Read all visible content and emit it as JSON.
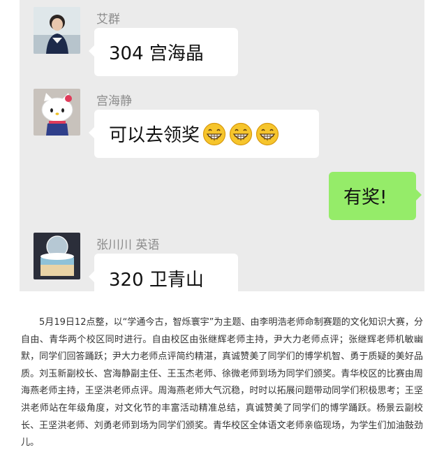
{
  "chat": {
    "messages": [
      {
        "sender": "艾群",
        "text": "304 宫海晶",
        "avatar": "avatar-woman-photo"
      },
      {
        "sender": "宫海静",
        "text": "可以去领奖",
        "emoji_count": 3,
        "emoji": "grinning-face-emoji",
        "avatar": "avatar-hello-kitty"
      },
      {
        "sender": "",
        "text": "有奖!",
        "self": true
      },
      {
        "sender": "张川川 英语",
        "text": "320 卫青山",
        "avatar": "avatar-cake-photo"
      }
    ],
    "colors": {
      "background": "#ebebeb",
      "self_bubble": "#95ec69",
      "other_bubble": "#ffffff"
    }
  },
  "article": {
    "paragraph": "5月19日12点整，以“学通今古，智烁寰宇”为主题、由李明浩老师命制赛题的文化知识大赛，分自由、青华两个校区同时进行。自由校区由张继辉老师主持，尹大力老师点评；张继辉老师机敏幽默，同学们回答踊跃；尹大力老师点评简约精湛，真诚赞美了同学们的博学机智、勇于质疑的美好品质。刘玉新副校长、宫海静副主任、王玉杰老师、徐微老师到场为同学们颁奖。青华校区的比赛由周海燕老师主持，王坚洪老师点评。周海燕老师大气沉稳，时时以拓展问题带动同学们积极思考；王坚洪老师站在年级角度，对文化节的丰富活动精准总结，真诚赞美了同学们的博学踊跃。杨景云副校长、王坚洪老师、刘勇老师到场为同学们颁奖。青华校区全体语文老师亲临现场，为学生们加油鼓劲儿。"
  }
}
